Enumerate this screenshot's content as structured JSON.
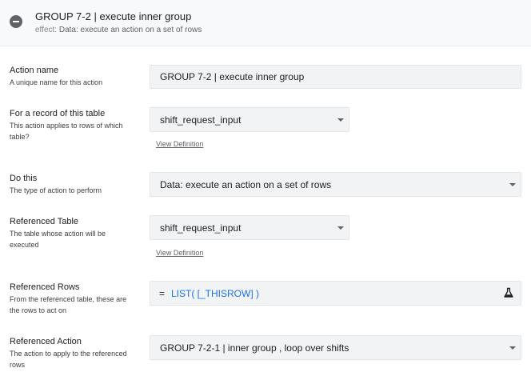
{
  "header": {
    "title": "GROUP 7-2 | execute inner group",
    "effect_prefix": "effect:",
    "effect_text": "Data: execute an action on a set of rows"
  },
  "action_name": {
    "label": "Action name",
    "sub": "A unique name for this action",
    "value": "GROUP 7-2 | execute inner group"
  },
  "table": {
    "label": "For a record of this table",
    "sub": "This action applies to rows of which table?",
    "value": "shift_request_input",
    "link": "View Definition"
  },
  "do_this": {
    "label": "Do this",
    "sub": "The type of action to perform",
    "value": "Data: execute an action on a set of rows"
  },
  "ref_table": {
    "label": "Referenced Table",
    "sub": "The table whose action will be executed",
    "value": "shift_request_input",
    "link": "View Definition"
  },
  "ref_rows": {
    "label": "Referenced Rows",
    "sub": "From the referenced table, these are the rows to act on",
    "eq": "=",
    "expression": "LIST( [_THISROW] )"
  },
  "ref_action": {
    "label": "Referenced Action",
    "sub": "The action to apply to the referenced rows",
    "value": "GROUP 7-2-1 | inner group , loop over shifts"
  },
  "colors": {
    "expression": "#1a73e8",
    "field_bg": "#f1f3f4",
    "header_bg": "#f8f9fa"
  }
}
